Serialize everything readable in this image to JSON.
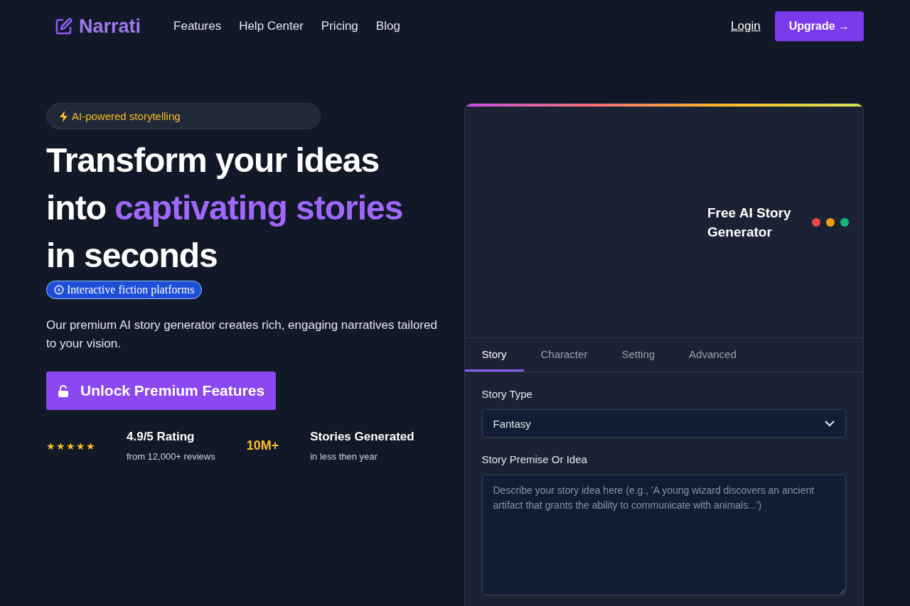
{
  "nav": {
    "logo": "Narrati",
    "links": [
      "Features",
      "Help Center",
      "Pricing",
      "Blog"
    ],
    "login": "Login",
    "upgrade": "Upgrade →"
  },
  "hero": {
    "badge": "AI-powered storytelling",
    "headline": {
      "lead": "Transform your ideas into",
      "highlight": "captivating stories",
      "tail": "in seconds"
    },
    "tag": "Interactive fiction platforms",
    "description": "Our premium AI story generator creates rich, engaging narratives tailored to your vision.",
    "cta": "Unlock Premium Features",
    "stats": [
      {
        "kind": "stars",
        "stars": 5,
        "title": "4.9/5 Rating",
        "subtitle": "from 12,000+ reviews"
      },
      {
        "kind": "figure",
        "figure": "10M+",
        "title": "Stories Generated",
        "subtitle": "in less then year"
      }
    ]
  },
  "panel": {
    "title": "Free AI Story Generator",
    "dots": [
      {
        "color": "#ef4444"
      },
      {
        "color": "#f59e0b"
      },
      {
        "color": "#10b981"
      }
    ],
    "tabs": [
      {
        "label": "Story",
        "selected": true
      },
      {
        "label": "Character",
        "selected": false
      },
      {
        "label": "Setting",
        "selected": false
      },
      {
        "label": "Advanced",
        "selected": false
      }
    ],
    "fields": [
      {
        "kind": "select",
        "label": "Story Type",
        "value": "Fantasy"
      },
      {
        "kind": "textarea",
        "label": "Story Premise Or Idea",
        "placeholder": "Describe your story idea here (e.g., 'A young wizard discovers an ancient artifact that grants the ability to communicate with animals...')"
      }
    ]
  }
}
